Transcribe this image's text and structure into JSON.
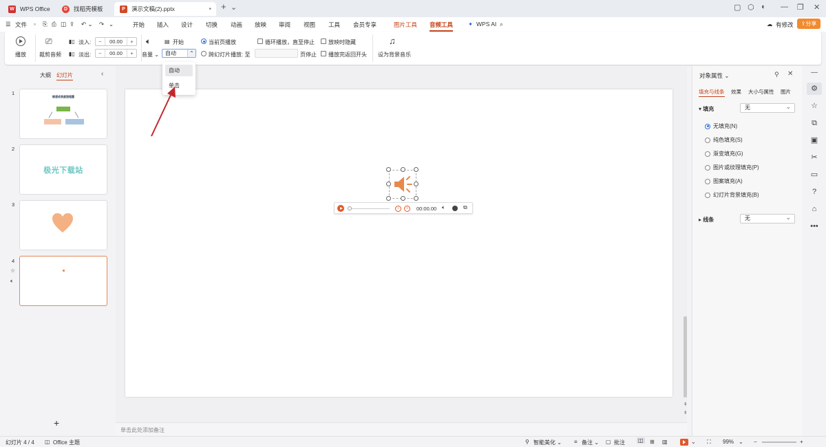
{
  "titlebar": {
    "tabs": [
      {
        "label": "WPS Office",
        "logo": "W"
      },
      {
        "label": "找稻壳模板",
        "logo": "D"
      },
      {
        "label": "演示文稿(2).pptx",
        "logo": "P"
      }
    ],
    "new_tab": "+",
    "tab_menu": "⌄"
  },
  "menubar": {
    "file": "文件",
    "items": [
      "开始",
      "插入",
      "设计",
      "切换",
      "动画",
      "放映",
      "审阅",
      "视图",
      "工具",
      "会员专享"
    ],
    "picture_tools": "图片工具",
    "audio_tools": "音频工具",
    "wps_ai": "WPS AI",
    "has_changes": "有修改",
    "share": "分享"
  },
  "ribbon": {
    "play": "播放",
    "trim_audio": "裁剪音频",
    "fade_in": "淡入:",
    "fade_in_value": "00.00",
    "fade_out": "淡出:",
    "fade_out_value": "00.00",
    "volume": "音量",
    "start": "开始",
    "start_value": "自动",
    "current_page": "当前页播放",
    "cross_slide": "跨幻灯片播放: 至",
    "page_stop": "页停止",
    "loop": "循环播放，直至停止",
    "hide_on_show": "放映时隐藏",
    "rewind": "播放完返回开头",
    "set_bg_music": "设为背景音乐"
  },
  "dropdown": {
    "options": [
      "自动",
      "单击"
    ]
  },
  "left_panel": {
    "tab_outline": "大纲",
    "tab_slides": "幻灯片",
    "slide_numbers": [
      "1",
      "2",
      "3",
      "4"
    ],
    "slide1_title": "極速成長度過程圖",
    "slide2_text": "极光下载站",
    "add": "+"
  },
  "audio_player": {
    "time": "00:00.00"
  },
  "notes": {
    "placeholder": "单击此处添加备注"
  },
  "right_panel": {
    "title": "对象属性",
    "tabs": [
      "填充与线条",
      "效果",
      "大小与属性",
      "图片"
    ],
    "fill_label": "填充",
    "fill_value": "无",
    "fill_options": [
      "无填充(N)",
      "纯色填充(S)",
      "渐变填充(G)",
      "图片或纹理填充(P)",
      "图案填充(A)",
      "幻灯片背景填充(B)"
    ],
    "line_label": "线条",
    "line_value": "无"
  },
  "statusbar": {
    "slide_count": "幻灯片 4 / 4",
    "theme": "Office 主题",
    "beautify": "智能美化",
    "notes": "备注",
    "comments": "批注",
    "zoom": "99%"
  },
  "colors": {
    "accent": "#c4441a",
    "audio_orange": "#e8894b",
    "selection_blue": "#2e6fd8"
  }
}
